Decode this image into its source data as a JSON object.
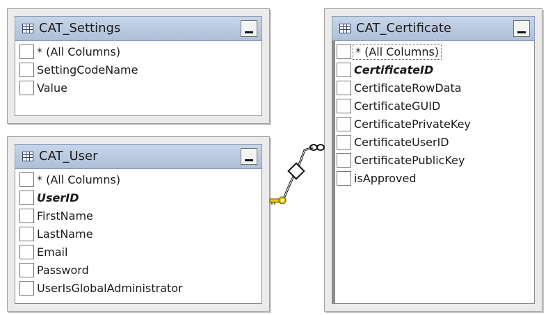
{
  "tables": {
    "settings": {
      "title": "CAT_Settings",
      "columns": [
        "* (All Columns)",
        "SettingCodeName",
        "Value"
      ]
    },
    "user": {
      "title": "CAT_User",
      "columns": [
        "* (All Columns)",
        "UserID",
        "FirstName",
        "LastName",
        "Email",
        "Password",
        "UserIsGlobalAdministrator"
      ],
      "primary_key": "UserID"
    },
    "certificate": {
      "title": "CAT_Certificate",
      "columns": [
        "* (All Columns)",
        "CertificateID",
        "CertificateRowData",
        "CertificateGUID",
        "CertificatePrivateKey",
        "CertificateUserID",
        "CertificatePublicKey",
        "isApproved"
      ],
      "primary_key": "CertificateID",
      "selected_row": "* (All Columns)"
    }
  },
  "relationship": {
    "from": "CAT_User",
    "to": "CAT_Certificate",
    "one_end_icon": "key-icon",
    "many_end_icon": "infinity-icon",
    "color": "#e8c800"
  }
}
